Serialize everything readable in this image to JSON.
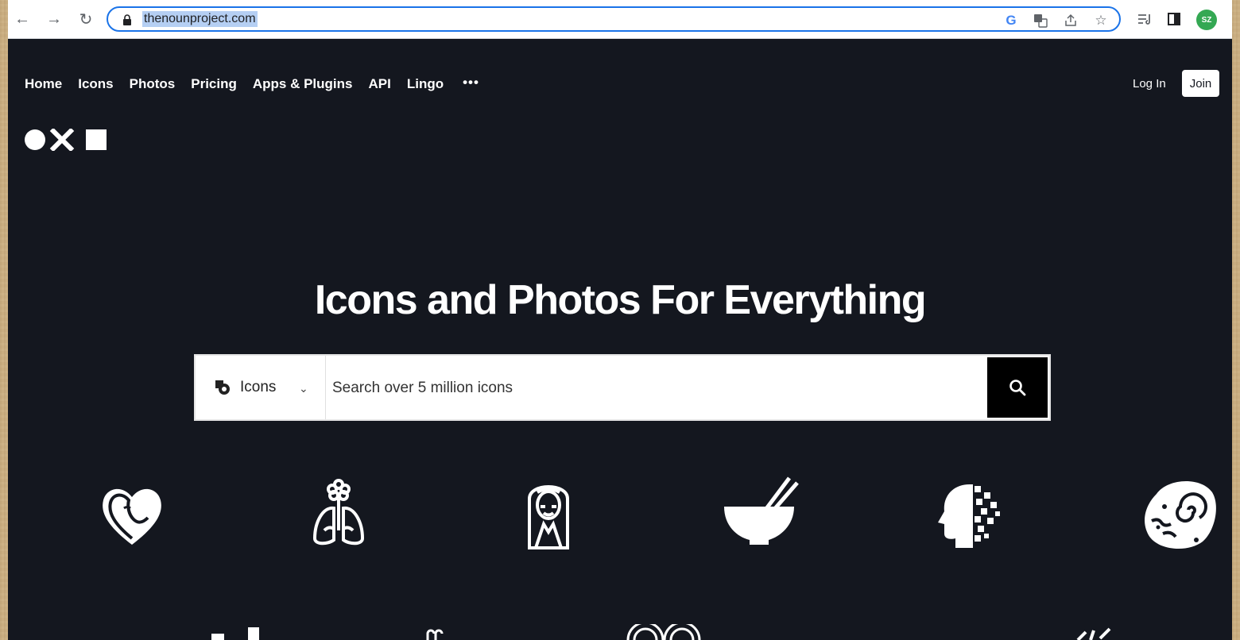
{
  "browser": {
    "url": "thenounproject.com",
    "profile_initials": "SZ",
    "icons": {
      "back": "back-arrow-icon",
      "forward": "forward-arrow-icon",
      "reload": "reload-icon",
      "lock": "lock-icon",
      "google": "google-icon",
      "translate": "translate-icon",
      "share": "share-icon",
      "bookmark": "star-icon",
      "reading_list": "reading-list-icon",
      "side_panel": "side-panel-icon"
    }
  },
  "site": {
    "nav": [
      "Home",
      "Icons",
      "Photos",
      "Pricing",
      "Apps & Plugins",
      "API",
      "Lingo"
    ],
    "more_label": "•••",
    "login_label": "Log In",
    "join_label": "Join",
    "hero_title": "Icons and Photos For Everything",
    "search": {
      "type_label": "Icons",
      "placeholder": "Search over 5 million icons"
    },
    "showcase": [
      "heart-face-icon",
      "flower-lungs-icon",
      "hooded-woman-icon",
      "bowl-chopsticks-icon",
      "pixel-head-icon",
      "spiral-cell-icon"
    ]
  },
  "colors": {
    "page_bg": "#14171f",
    "accent": "#1a73e8",
    "avatar": "#34a853"
  }
}
